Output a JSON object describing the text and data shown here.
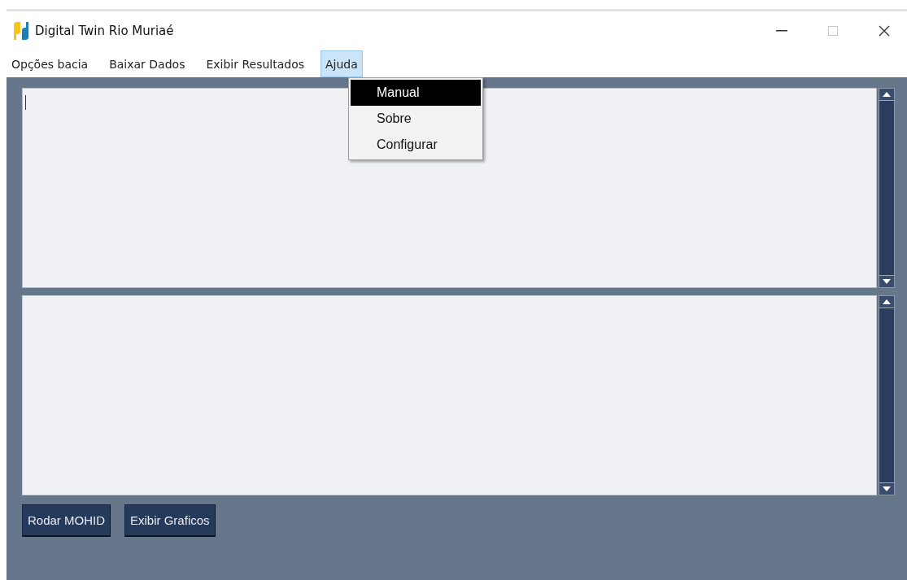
{
  "window": {
    "title": "Digital Twin Rio Muriaé",
    "maximize_disabled": true
  },
  "menu_bar": [
    {
      "label": "Opções bacia",
      "selected": false
    },
    {
      "label": "Baixar Dados",
      "selected": false
    },
    {
      "label": "Exibir Resultados",
      "selected": false
    },
    {
      "label": "Ajuda",
      "selected": true
    }
  ],
  "dropdown": [
    {
      "label": "Manual",
      "selected": true
    },
    {
      "label": "Sobre",
      "selected": false
    },
    {
      "label": "Configurar",
      "selected": false
    }
  ],
  "text_areas": [
    {
      "focused": true
    },
    {
      "focused": false
    }
  ],
  "buttons": [
    "Rodar MOHID",
    "Exibir Graficos"
  ]
}
